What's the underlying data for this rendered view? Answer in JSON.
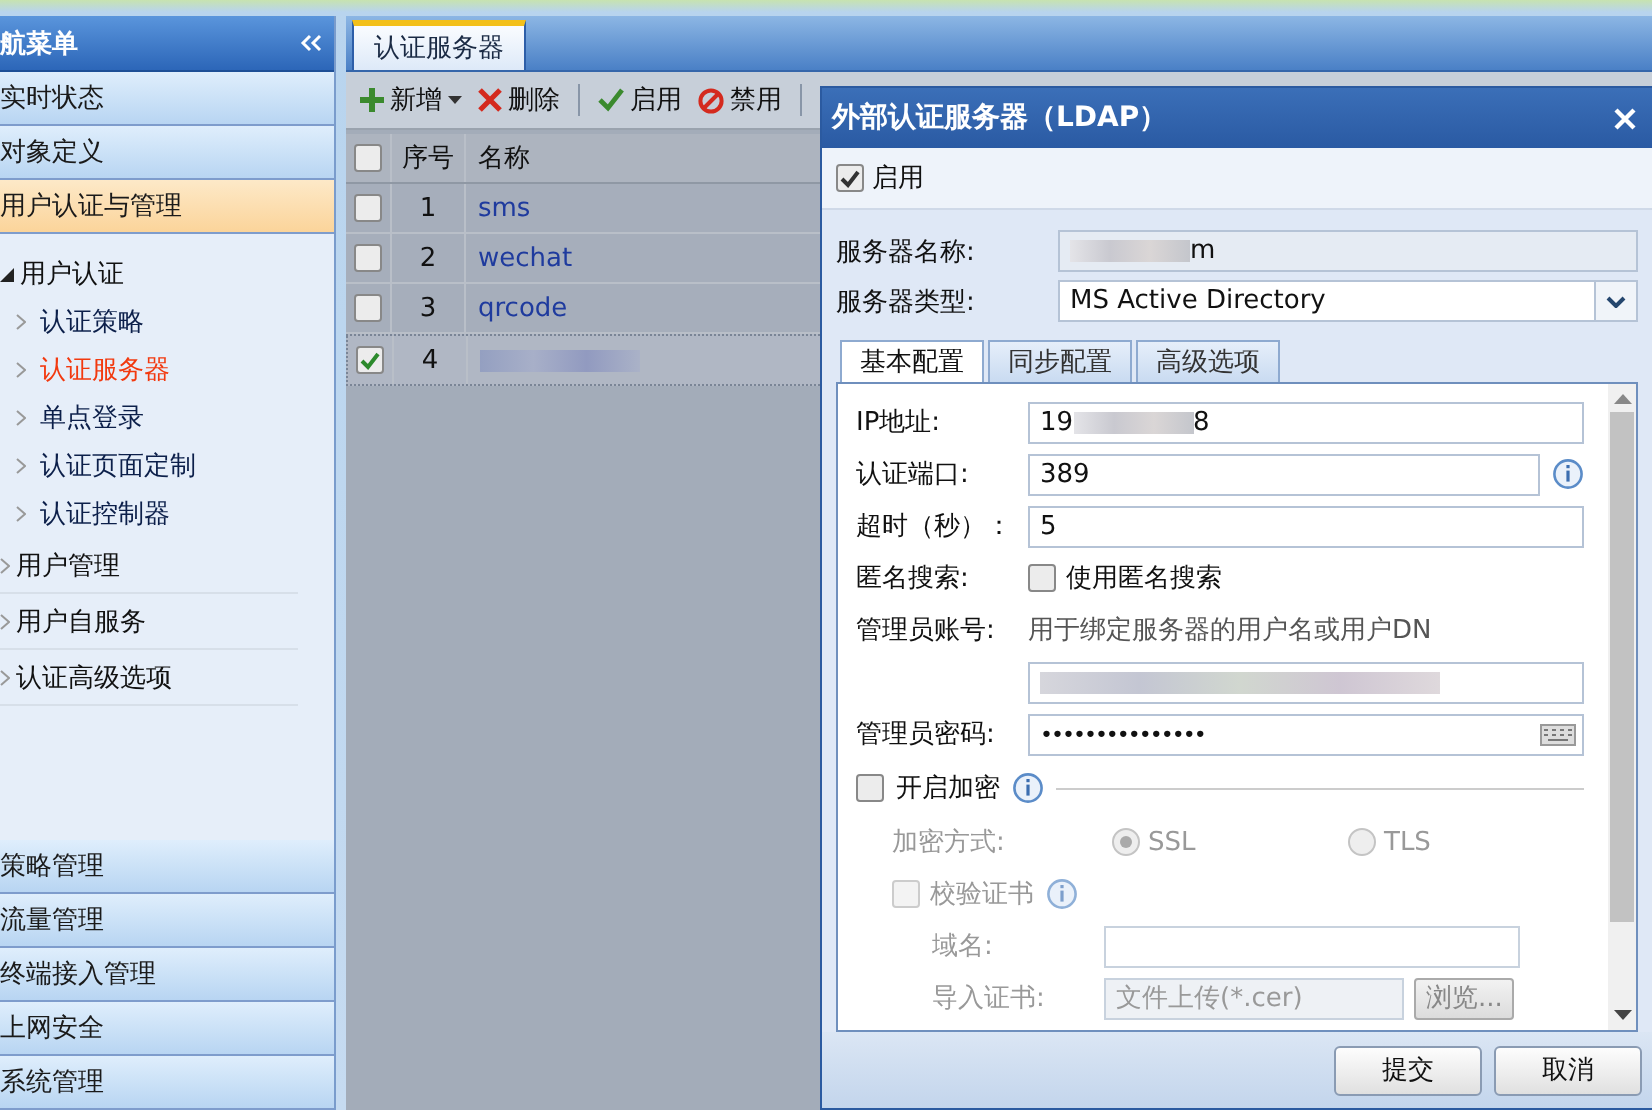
{
  "sidebar": {
    "title": "航菜单",
    "items": [
      {
        "label": "实时状态",
        "selected": false
      },
      {
        "label": "对象定义",
        "selected": false
      },
      {
        "label": "用户认证与管理",
        "selected": true
      }
    ],
    "tree": [
      {
        "label": "用户认证",
        "expanded": true,
        "children": [
          {
            "label": "认证策略",
            "selected": false
          },
          {
            "label": "认证服务器",
            "selected": true
          },
          {
            "label": "单点登录",
            "selected": false
          },
          {
            "label": "认证页面定制",
            "selected": false
          },
          {
            "label": "认证控制器",
            "selected": false
          }
        ]
      },
      {
        "label": "用户管理",
        "expanded": false
      },
      {
        "label": "用户自服务",
        "expanded": false
      },
      {
        "label": "认证高级选项",
        "expanded": false
      }
    ],
    "bottom_items": [
      {
        "label": "策略管理",
        "selected": false
      },
      {
        "label": "流量管理",
        "selected": false
      },
      {
        "label": "终端接入管理",
        "selected": false
      },
      {
        "label": "上网安全",
        "selected": false
      },
      {
        "label": "系统管理",
        "selected": false
      }
    ]
  },
  "main": {
    "tab": "认证服务器",
    "toolbar": [
      {
        "label": "新增",
        "kind": "add"
      },
      {
        "label": "删除",
        "kind": "delete"
      },
      {
        "label": "启用",
        "kind": "enable"
      },
      {
        "label": "禁用",
        "kind": "disable"
      }
    ],
    "table": {
      "select_all_checked": false,
      "columns": [
        "序号",
        "名称"
      ],
      "rows": [
        {
          "index": "1",
          "name": "sms",
          "checked": false,
          "selected": false
        },
        {
          "index": "2",
          "name": "wechat",
          "checked": false,
          "selected": false
        },
        {
          "index": "3",
          "name": "qrcode",
          "checked": false,
          "selected": false
        },
        {
          "index": "4",
          "checked": true,
          "selected": true
        }
      ]
    }
  },
  "dialog": {
    "title": "外部认证服务器（LDAP）",
    "enabled": {
      "label": "启用",
      "checked": true
    },
    "server_name": {
      "label": "服务器名称:",
      "value": "m"
    },
    "server_type": {
      "label": "服务器类型:",
      "value": "MS Active Directory"
    },
    "tabs": [
      {
        "label": "基本配置",
        "selected": true
      },
      {
        "label": "同步配置",
        "selected": false
      },
      {
        "label": "高级选项",
        "selected": false
      }
    ],
    "ip": {
      "label": "IP地址:",
      "value_start": "19",
      "value_end": "8"
    },
    "port": {
      "label": "认证端口:",
      "value": "389"
    },
    "timeout": {
      "label": "超时（秒）：",
      "value": "5"
    },
    "anonymous": {
      "label": "匿名搜索:",
      "option": "使用匿名搜索",
      "checked": false
    },
    "admin_account": {
      "label": "管理员账号:",
      "hint": "用于绑定服务器的用户名或用户DN"
    },
    "admin_password": {
      "label": "管理员密码:",
      "value": "•••••••••••••••"
    },
    "encryption": {
      "label": "开启加密",
      "checked": false,
      "disabled_section": true,
      "method_label": "加密方式:",
      "methods": [
        {
          "label": "SSL",
          "selected": true
        },
        {
          "label": "TLS",
          "selected": false
        }
      ],
      "verify": {
        "label": "校验证书",
        "checked": false
      },
      "domain_label": "域名:",
      "import_label": "导入证书:",
      "import_placeholder": "文件上传(*.cer)",
      "browse": "浏览..."
    },
    "buttons": [
      "提交",
      "取消"
    ]
  }
}
